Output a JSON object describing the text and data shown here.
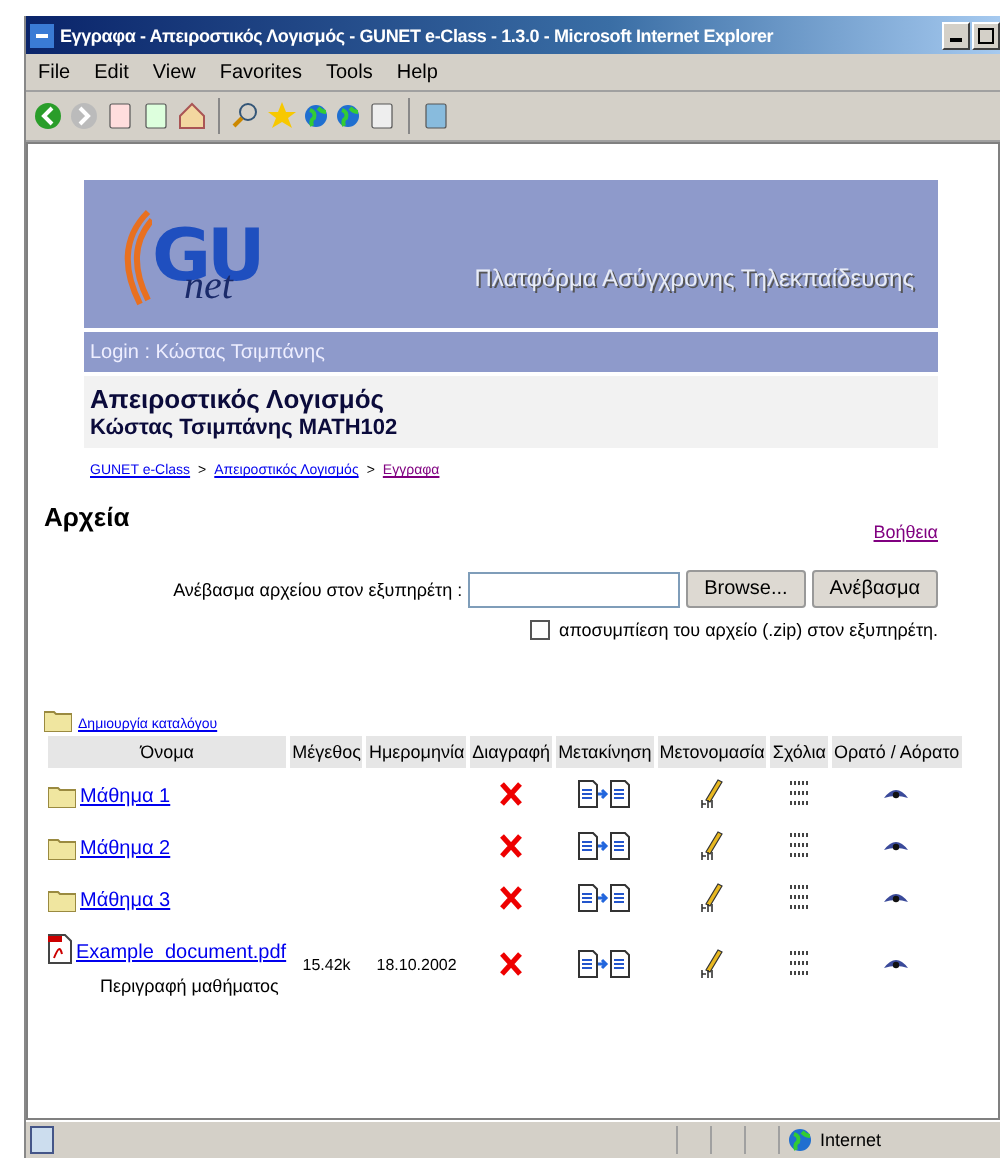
{
  "window": {
    "title": "Εγγραφα - Απειροστικός Λογισμός - GUNET e-Class - 1.3.0 - Microsoft Internet Explorer"
  },
  "menu": [
    "File",
    "Edit",
    "View",
    "Favorites",
    "Tools",
    "Help"
  ],
  "banner": {
    "logo_main": "GU",
    "logo_sub": "net",
    "tagline": "Πλατφόρμα Ασύγχρονης Τηλεκπαίδευσης",
    "login": "Login : Κώστας Τσιμπάνης"
  },
  "course": {
    "title": "Απειροστικός Λογισμός",
    "subtitle": "Κώστας Τσιμπάνης MATH102"
  },
  "breadcrumb": [
    {
      "label": "GUNET e-Class",
      "visited": false
    },
    {
      "label": "Απειροστικός Λογισμός",
      "visited": false
    },
    {
      "label": "Εγγραφα",
      "visited": true
    }
  ],
  "breadcrumb_separator": ">",
  "heading": "Αρχεία",
  "help_link": "Βοήθεια",
  "upload": {
    "label": "Ανέβασμα αρχείου στον εξυπηρέτη :",
    "browse": "Browse...",
    "submit": "Ανέβασμα",
    "unzip_label": "αποσυμπίεση του αρχείο (.zip) στον εξυπηρέτη.",
    "unzip_checked": false
  },
  "create_folder": "Δημιουργία καταλόγου",
  "table": {
    "columns": [
      "Όνομα",
      "Μέγεθος",
      "Ημερομηνία",
      "Διαγραφή",
      "Μετακίνηση",
      "Μετονομασία",
      "Σχόλια",
      "Ορατό / Αόρατο"
    ],
    "rows": [
      {
        "kind": "folder",
        "name": "Μάθημα 1"
      },
      {
        "kind": "folder",
        "name": "Μάθημα 2"
      },
      {
        "kind": "folder",
        "name": "Μάθημα 3"
      },
      {
        "kind": "file",
        "name": "Example_document.pdf",
        "size": "15.42k",
        "date": "18.10.2002",
        "description": "Περιγραφή μαθήματος"
      }
    ]
  },
  "status_bar": {
    "zone": "Internet"
  }
}
